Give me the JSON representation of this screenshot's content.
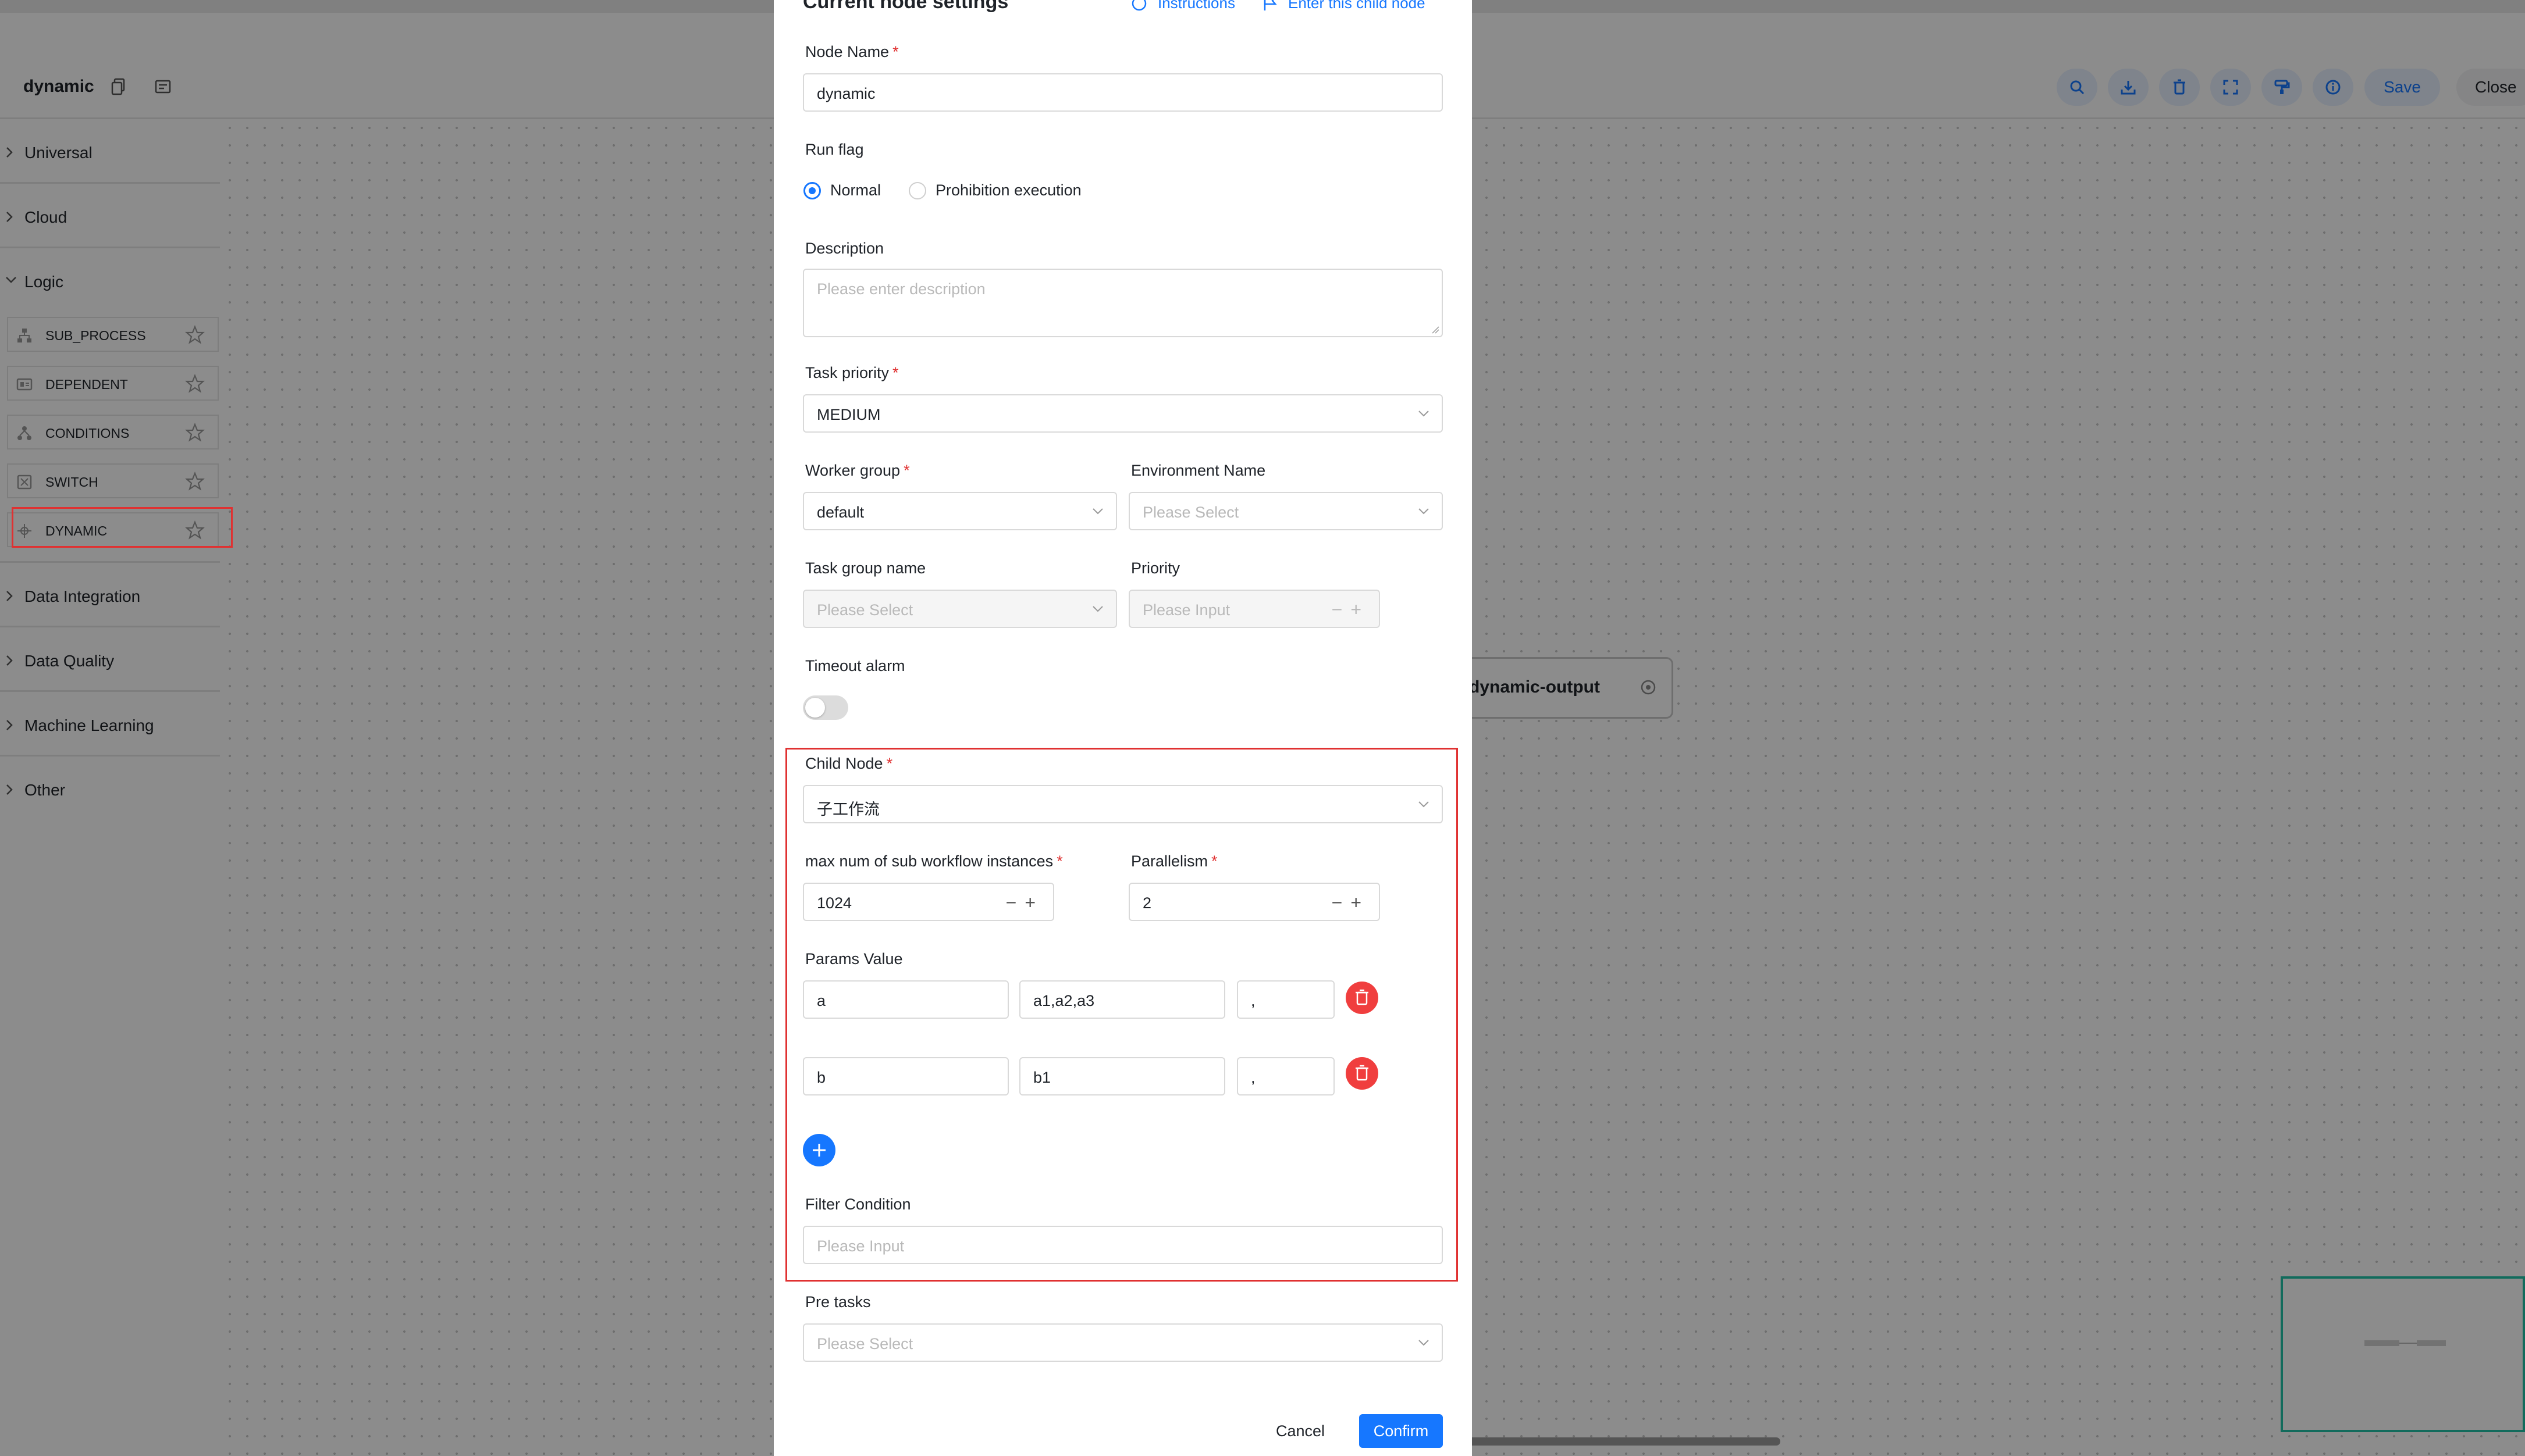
{
  "toolbar": {
    "workflow_name": "dynamic",
    "save_label": "Save",
    "close_label": "Close"
  },
  "sidebar": {
    "categories": [
      {
        "label": "Universal"
      },
      {
        "label": "Cloud"
      },
      {
        "label": "Logic"
      },
      {
        "label": "Data Integration"
      },
      {
        "label": "Data Quality"
      },
      {
        "label": "Machine Learning"
      },
      {
        "label": "Other"
      }
    ],
    "logic_tasks": [
      {
        "label": "SUB_PROCESS"
      },
      {
        "label": "DEPENDENT"
      },
      {
        "label": "CONDITIONS"
      },
      {
        "label": "SWITCH"
      },
      {
        "label": "DYNAMIC"
      }
    ]
  },
  "canvas": {
    "node_label": "dynamic-output"
  },
  "drawer": {
    "title": "Current node settings",
    "instructions_link": "Instructions",
    "enter_child_link": "Enter this child node",
    "node_name": {
      "label": "Node Name",
      "value": "dynamic"
    },
    "run_flag": {
      "label": "Run flag",
      "options": [
        "Normal",
        "Prohibition execution"
      ],
      "selected": "Normal"
    },
    "description": {
      "label": "Description",
      "placeholder": "Please enter description"
    },
    "task_priority": {
      "label": "Task priority",
      "value": "MEDIUM"
    },
    "worker_group": {
      "label": "Worker group",
      "value": "default"
    },
    "environment_name": {
      "label": "Environment Name",
      "placeholder": "Please Select"
    },
    "task_group_name": {
      "label": "Task group name",
      "placeholder": "Please Select"
    },
    "priority": {
      "label": "Priority",
      "placeholder": "Please Input"
    },
    "timeout_alarm": {
      "label": "Timeout alarm",
      "enabled": false
    },
    "child_node": {
      "label": "Child Node",
      "value": "子工作流"
    },
    "max_instances": {
      "label": "max num of sub workflow instances",
      "value": "1024"
    },
    "parallelism": {
      "label": "Parallelism",
      "value": "2"
    },
    "params": {
      "label": "Params Value",
      "rows": [
        {
          "name": "a",
          "value": "a1,a2,a3",
          "separator": ","
        },
        {
          "name": "b",
          "value": "b1",
          "separator": ","
        }
      ]
    },
    "filter_condition": {
      "label": "Filter Condition",
      "placeholder": "Please Input"
    },
    "pre_tasks": {
      "label": "Pre tasks",
      "placeholder": "Please Select"
    },
    "cancel_label": "Cancel",
    "confirm_label": "Confirm"
  },
  "colors": {
    "accent": "#1677ff",
    "danger": "#f03e3e",
    "highlight": "#e03131",
    "minimap_border": "#22c3a8"
  }
}
